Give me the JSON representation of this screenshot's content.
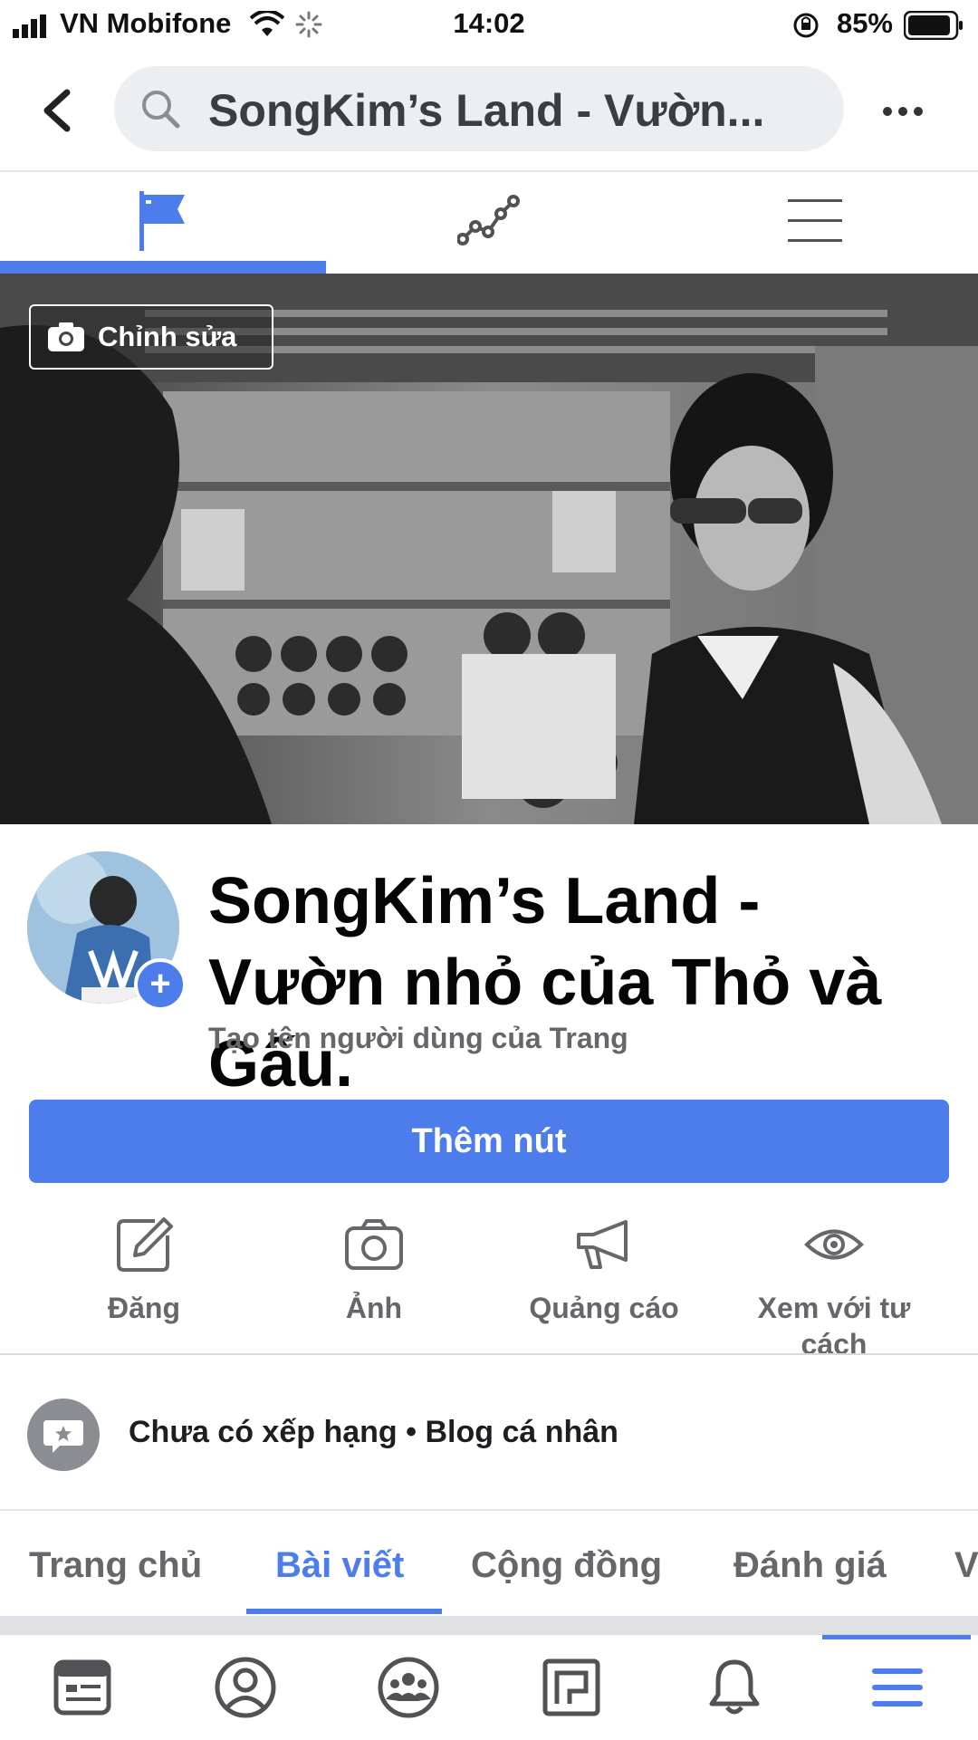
{
  "status_bar": {
    "carrier": "VN Mobifone",
    "time": "14:02",
    "battery": "85%"
  },
  "header": {
    "search_title": "SongKim’s Land - Vườn..."
  },
  "cover": {
    "edit_label": "Chỉnh sửa"
  },
  "profile": {
    "page_name": "SongKim’s Land - Vườn nhỏ của Thỏ và Gấu.",
    "username_prompt": "Tạo tên người dùng của Trang",
    "cta_label": "Thêm nút"
  },
  "actions": [
    {
      "label": "Đăng",
      "icon": "edit-icon"
    },
    {
      "label": "Ảnh",
      "icon": "camera-icon"
    },
    {
      "label": "Quảng cáo",
      "icon": "megaphone-icon"
    },
    {
      "label": "Xem với tư cách",
      "icon": "eye-icon"
    }
  ],
  "rating": {
    "text": "Chưa có xếp hạng • Blog cá nhân"
  },
  "page_tabs": [
    {
      "label": "Trang chủ"
    },
    {
      "label": "Bài viết",
      "active": true
    },
    {
      "label": "Cộng đồng"
    },
    {
      "label": "Đánh giá"
    },
    {
      "label": "V"
    }
  ],
  "colors": {
    "accent": "#4c7dea",
    "muted_text": "#65676b"
  }
}
